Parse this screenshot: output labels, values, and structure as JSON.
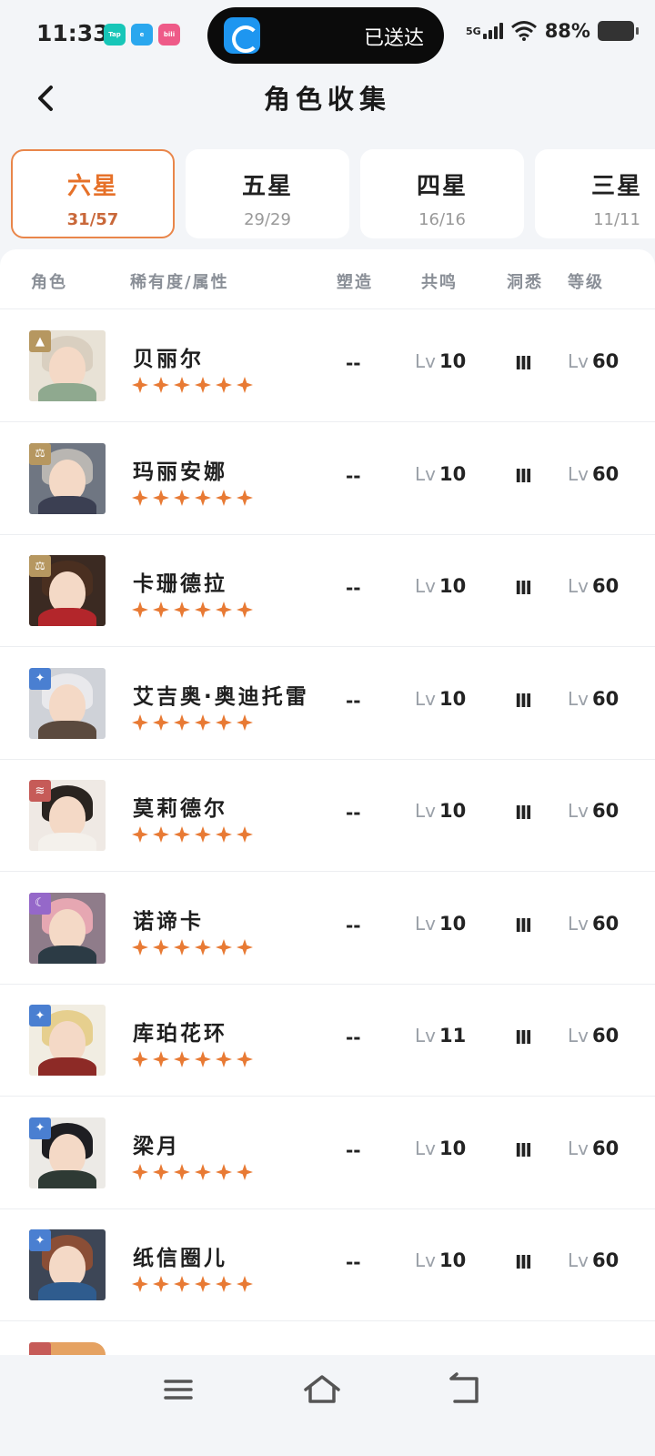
{
  "status_bar": {
    "time": "11:33",
    "app_icons": [
      "Tap",
      "e",
      "bili"
    ],
    "island_text": "已送达",
    "network": "5G",
    "battery": "88%"
  },
  "header": {
    "title": "角色收集"
  },
  "tabs": [
    {
      "name": "六星",
      "count": "31/57",
      "active": true
    },
    {
      "name": "五星",
      "count": "29/29",
      "active": false
    },
    {
      "name": "四星",
      "count": "16/16",
      "active": false
    },
    {
      "name": "三星",
      "count": "11/11",
      "active": false
    }
  ],
  "columns": {
    "character": "角色",
    "rarity_attr": "稀有度/属性",
    "forge": "塑造",
    "resonance": "共鸣",
    "insight": "洞悉",
    "level": "等级"
  },
  "lv_prefix": "Lv",
  "characters": [
    {
      "name": "贝丽尔",
      "forge": "--",
      "resonance": "10",
      "insight": "Ⅲ",
      "level": "60",
      "attr_icon": "triangle-icon",
      "attr_color": "#b69760",
      "hair": "#d9cfc0",
      "bg": "#e8e2d6",
      "outfit": "#8fa98f"
    },
    {
      "name": "玛丽安娜",
      "forge": "--",
      "resonance": "10",
      "insight": "Ⅲ",
      "level": "60",
      "attr_icon": "scales-icon",
      "attr_color": "#b69760",
      "hair": "#b9b6b2",
      "bg": "#6f7682",
      "outfit": "#3b3f52"
    },
    {
      "name": "卡珊德拉",
      "forge": "--",
      "resonance": "10",
      "insight": "Ⅲ",
      "level": "60",
      "attr_icon": "scales-icon",
      "attr_color": "#b69760",
      "hair": "#4a2f20",
      "bg": "#3b2a22",
      "outfit": "#b3262b"
    },
    {
      "name": "艾吉奥·奥迪托雷",
      "forge": "--",
      "resonance": "10",
      "insight": "Ⅲ",
      "level": "60",
      "attr_icon": "star4-icon",
      "attr_color": "#4a7fd1",
      "hair": "#e9e9ec",
      "bg": "#cfd2d8",
      "outfit": "#5b4a3e"
    },
    {
      "name": "莫莉德尔",
      "forge": "--",
      "resonance": "10",
      "insight": "Ⅲ",
      "level": "60",
      "attr_icon": "claw-icon",
      "attr_color": "#c65b58",
      "hair": "#2a2420",
      "bg": "#efe9e4",
      "outfit": "#f4f1ec"
    },
    {
      "name": "诺谛卡",
      "forge": "--",
      "resonance": "10",
      "insight": "Ⅲ",
      "level": "60",
      "attr_icon": "moon-icon",
      "attr_color": "#9568c9",
      "hair": "#e6a7b2",
      "bg": "#8f7c8a",
      "outfit": "#2c3b45"
    },
    {
      "name": "库珀花环",
      "forge": "--",
      "resonance": "11",
      "insight": "Ⅲ",
      "level": "60",
      "attr_icon": "star4-icon",
      "attr_color": "#4a7fd1",
      "hair": "#e6cf8e",
      "bg": "#f1ede2",
      "outfit": "#8d2a26"
    },
    {
      "name": "梁月",
      "forge": "--",
      "resonance": "10",
      "insight": "Ⅲ",
      "level": "60",
      "attr_icon": "star4-icon",
      "attr_color": "#4a7fd1",
      "hair": "#1e1e22",
      "bg": "#eceae6",
      "outfit": "#2e3a34"
    },
    {
      "name": "纸信圈儿",
      "forge": "--",
      "resonance": "10",
      "insight": "Ⅲ",
      "level": "60",
      "attr_icon": "star4-icon",
      "attr_color": "#4a7fd1",
      "hair": "#8a4e36",
      "bg": "#3d4656",
      "outfit": "#2f5c8e"
    }
  ],
  "star_color": "#e87a34",
  "accent_color": "#e67129"
}
